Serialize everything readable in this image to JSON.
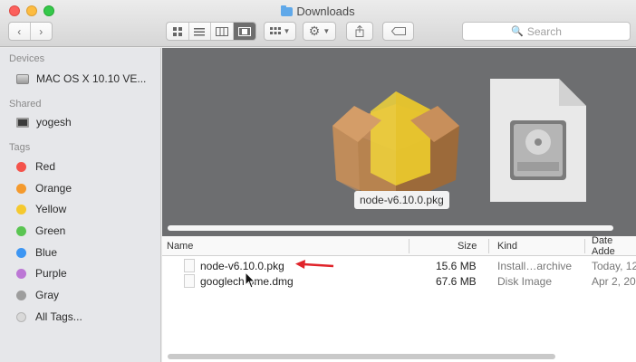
{
  "window": {
    "title": "Downloads"
  },
  "toolbar": {
    "back_icon": "chevron-left-icon",
    "forward_icon": "chevron-right-icon",
    "view_modes": [
      "icon-view-icon",
      "list-view-icon",
      "column-view-icon",
      "cover-flow-icon"
    ],
    "active_view": "cover-flow-icon",
    "arrange_icon": "arrange-grid-icon",
    "action_icon": "gear-icon",
    "share_icon": "share-icon",
    "tag_icon": "tag-icon",
    "search_placeholder": "Search"
  },
  "sidebar": {
    "devices_heading": "Devices",
    "devices": [
      {
        "label": "MAC OS X 10.10 VE...",
        "icon": "hard-disk-icon"
      }
    ],
    "shared_heading": "Shared",
    "shared": [
      {
        "label": "yogesh",
        "icon": "computer-icon"
      }
    ],
    "tags_heading": "Tags",
    "tags": [
      {
        "label": "Red",
        "color": "#f4534b"
      },
      {
        "label": "Orange",
        "color": "#f49a2d"
      },
      {
        "label": "Yellow",
        "color": "#f5c92f"
      },
      {
        "label": "Green",
        "color": "#5ac552"
      },
      {
        "label": "Blue",
        "color": "#3d96f3"
      },
      {
        "label": "Purple",
        "color": "#bc77d5"
      },
      {
        "label": "Gray",
        "color": "#9d9d9d"
      }
    ],
    "all_tags_label": "All Tags..."
  },
  "preview": {
    "selected_label": "node-v6.10.0.pkg"
  },
  "list": {
    "columns": [
      "Name",
      "Size",
      "Kind",
      "Date Adde"
    ],
    "rows": [
      {
        "name": "node-v6.10.0.pkg",
        "size": "15.6 MB",
        "kind": "Install…archive",
        "date": "Today, 12"
      },
      {
        "name": "googlechrome.dmg",
        "size": "67.6 MB",
        "kind": "Disk Image",
        "date": "Apr 2, 20"
      }
    ]
  },
  "annotation": {
    "color": "#e0242a"
  }
}
